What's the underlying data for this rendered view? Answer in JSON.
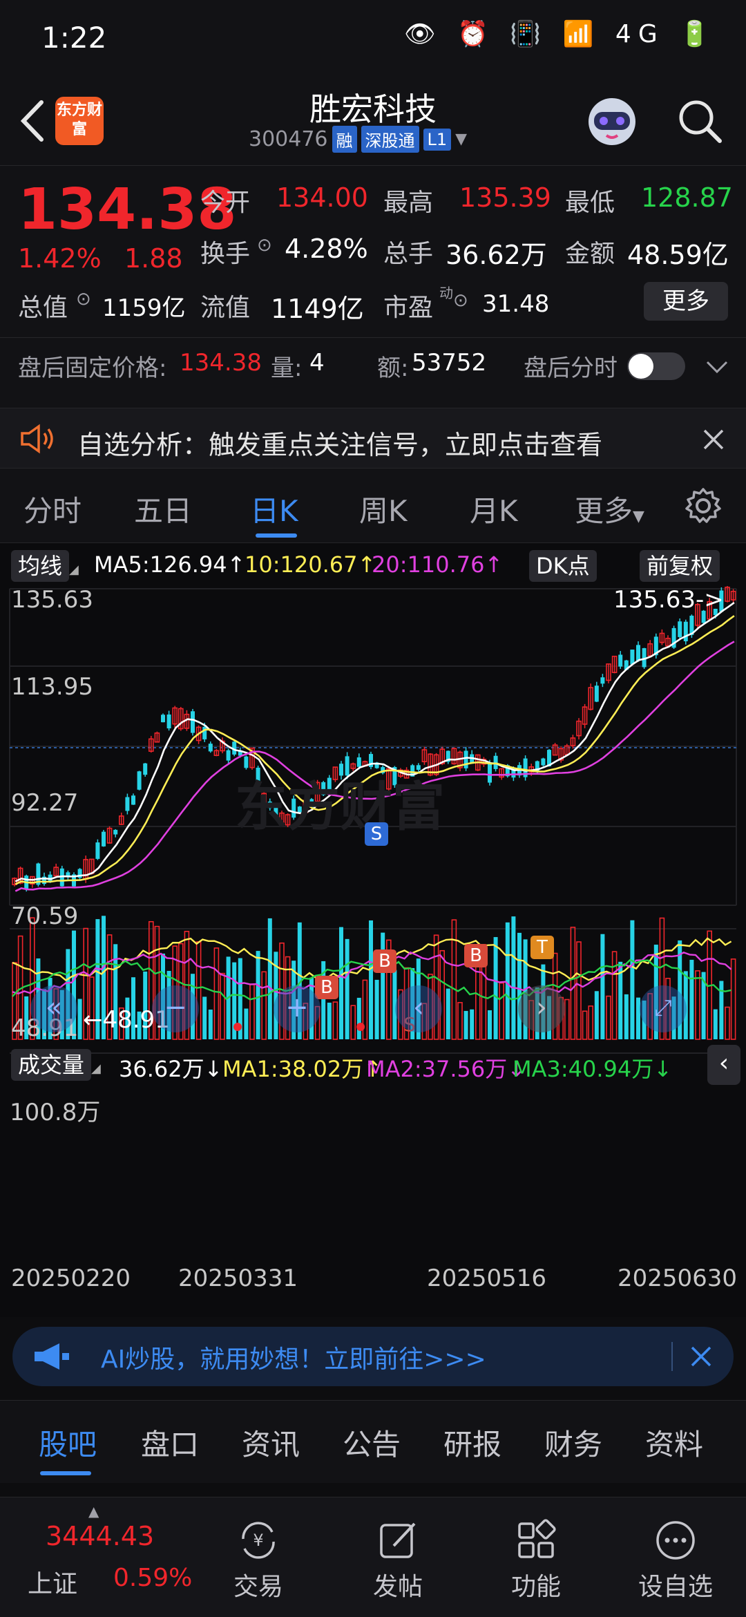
{
  "status_bar": {
    "time": "1:22",
    "icons": "👁 ⏰ 📳 📶 4G 🔋"
  },
  "header": {
    "logo_text": "东方财富",
    "stock_name": "胜宏科技",
    "stock_code": "300476",
    "tags": [
      "融",
      "深股通",
      "L1"
    ]
  },
  "quote": {
    "price": "134.38",
    "change_pct": "1.42%",
    "change": "1.88",
    "open_label": "今开",
    "open": "134.00",
    "high_label": "最高",
    "high": "135.39",
    "low_label": "最低",
    "low": "128.87",
    "turnover_label": "换手",
    "turnover": "4.28%",
    "volume_label": "总手",
    "volume": "36.62万",
    "amount_label": "金额",
    "amount": "48.59亿",
    "mktcap_label": "总值",
    "mktcap": "1159亿",
    "float_label": "流值",
    "float": "1149亿",
    "pe_label": "市盈",
    "pe_sup": "动",
    "pe": "31.48",
    "more": "更多",
    "after_label": "盘后固定价格:",
    "after_price": "134.38",
    "after_vol_label": "量:",
    "after_vol": "4",
    "after_amt_label": "额:",
    "after_amt": "53752",
    "after_time_label": "盘后分时"
  },
  "notice": {
    "text": "自选分析：触发重点关注信号，立即点击查看"
  },
  "tabs": [
    "分时",
    "五日",
    "日K",
    "周K",
    "月K",
    "更多"
  ],
  "chart": {
    "ma_chip": "均线",
    "ma5": "MA5:126.94↑",
    "ma10": "10:120.67↑",
    "ma20": "20:110.76↑",
    "dk_chip": "DK点",
    "fq_chip": "前复权",
    "y_labels": [
      "135.63",
      "113.95",
      "92.27",
      "70.59",
      "48.91"
    ],
    "high_mark": "135.63->",
    "low_mark": "←48.91",
    "watermark": "东方财富",
    "signals": [
      "S",
      "B",
      "B",
      "B",
      "T",
      "B",
      "S"
    ],
    "vol_chip": "成交量",
    "vol_val": "36.62万↓",
    "vma1": "MA1:38.02万↑",
    "vma2": "MA2:37.56万↓",
    "vma3": "MA3:40.94万↓",
    "vol_max": "100.8万",
    "dates": [
      "20250220",
      "20250331",
      "20250516",
      "20250630"
    ],
    "colors": {
      "up": "#f0262c",
      "down": "#27d3e6",
      "ma5": "#ffffff",
      "ma10": "#ffee55",
      "ma20": "#e040e0",
      "ma3": "#27d34b"
    }
  },
  "ai_banner": {
    "text": "AI炒股，就用妙想！立即前往>>>"
  },
  "bottom_tabs": [
    "股吧",
    "盘口",
    "资讯",
    "公告",
    "研报",
    "财务",
    "资料"
  ],
  "nav": {
    "index_value": "3444.43",
    "index_name": "上证",
    "index_pct": "0.59%",
    "items": [
      "交易",
      "发帖",
      "功能",
      "设自选"
    ]
  }
}
